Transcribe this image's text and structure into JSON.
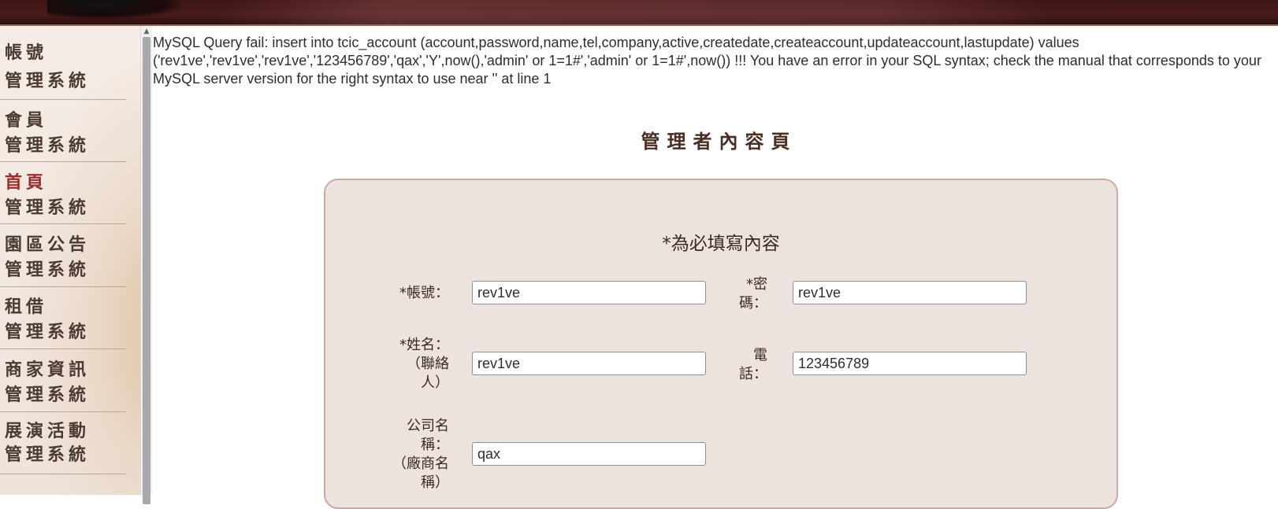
{
  "error_message": "MySQL Query fail: insert into tcic_account (account,password,name,tel,company,active,createdate,createaccount,updateaccount,lastupdate) values ('rev1ve','rev1ve','rev1ve','123456789','qax','Y',now(),'admin' or 1=1#','admin' or 1=1#',now()) !!! You have an error in your SQL syntax; check the manual that corresponds to your MySQL server version for the right syntax to use near '' at line 1",
  "sidebar": {
    "items": [
      {
        "line1": "帳號",
        "line2": "管理系統"
      },
      {
        "line1": "會員",
        "line2": "管理系統"
      },
      {
        "line1": "首頁",
        "line2": "管理系統"
      },
      {
        "line1": "園區公告",
        "line2": "管理系統"
      },
      {
        "line1": "租借",
        "line2": "管理系統"
      },
      {
        "line1": "商家資訊",
        "line2": "管理系統"
      },
      {
        "line1": "展演活動",
        "line2": "管理系統"
      }
    ]
  },
  "page_title": "管理者內容頁",
  "form": {
    "required_note": "*為必填寫內容",
    "account": {
      "label": "*帳號：",
      "value": "rev1ve"
    },
    "password": {
      "label_line1": "*密",
      "label_line2": "碼：",
      "value": "rev1ve"
    },
    "name": {
      "label_line1": "*姓名：",
      "label_line2": "（聯絡",
      "label_line3": "人）",
      "value": "rev1ve"
    },
    "tel": {
      "label_line1": "電",
      "label_line2": "話：",
      "value": "123456789"
    },
    "company": {
      "label_line1": "公司名",
      "label_line2": "稱：",
      "label_line3": "（廠商名",
      "label_line4": "稱）",
      "value": "qax"
    }
  },
  "colors": {
    "banner": "#4a1c1c",
    "panel_bg": "#ece3df",
    "panel_border": "#c7aba0",
    "active_nav": "#9b2a2a"
  }
}
